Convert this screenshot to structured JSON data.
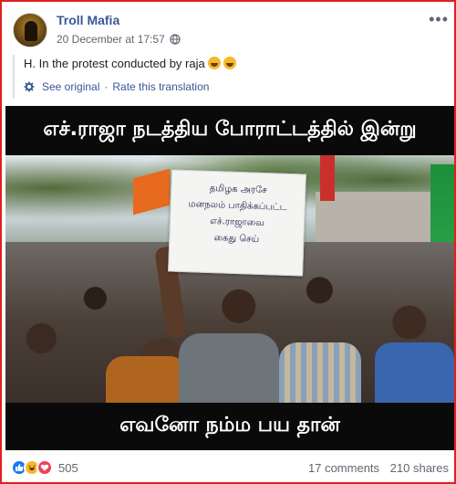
{
  "post": {
    "page_name": "Troll Mafia",
    "timestamp": "20 December at 17:57",
    "audience_icon": "globe-icon",
    "more_icon": "ellipsis-icon",
    "text": "H. In the protest conducted by raja",
    "text_emojis": [
      "rolling-laughing-emoji",
      "rolling-laughing-emoji"
    ],
    "translation_links": {
      "see_original": "See original",
      "separator": "·",
      "rate": "Rate this translation"
    }
  },
  "image": {
    "caption_top": "எச்.ராஜா நடத்திய போராட்டத்தில் இன்று",
    "caption_bottom": "எவனோ நம்ம பய தான்",
    "sign_lines": [
      "தமிழக அரசே",
      "மனநலம் பாதிக்கப்பட்ட",
      "எச்.ராஜாவை",
      "கைது செய்"
    ]
  },
  "reactions": {
    "types": [
      "like",
      "haha",
      "love"
    ],
    "count": "505",
    "comments": "17 comments",
    "shares": "210 shares"
  },
  "colors": {
    "link": "#385898",
    "meta": "#616770",
    "border": "#e02020",
    "like": "#1877f2",
    "haha": "#f7b928",
    "love": "#f33e58"
  }
}
